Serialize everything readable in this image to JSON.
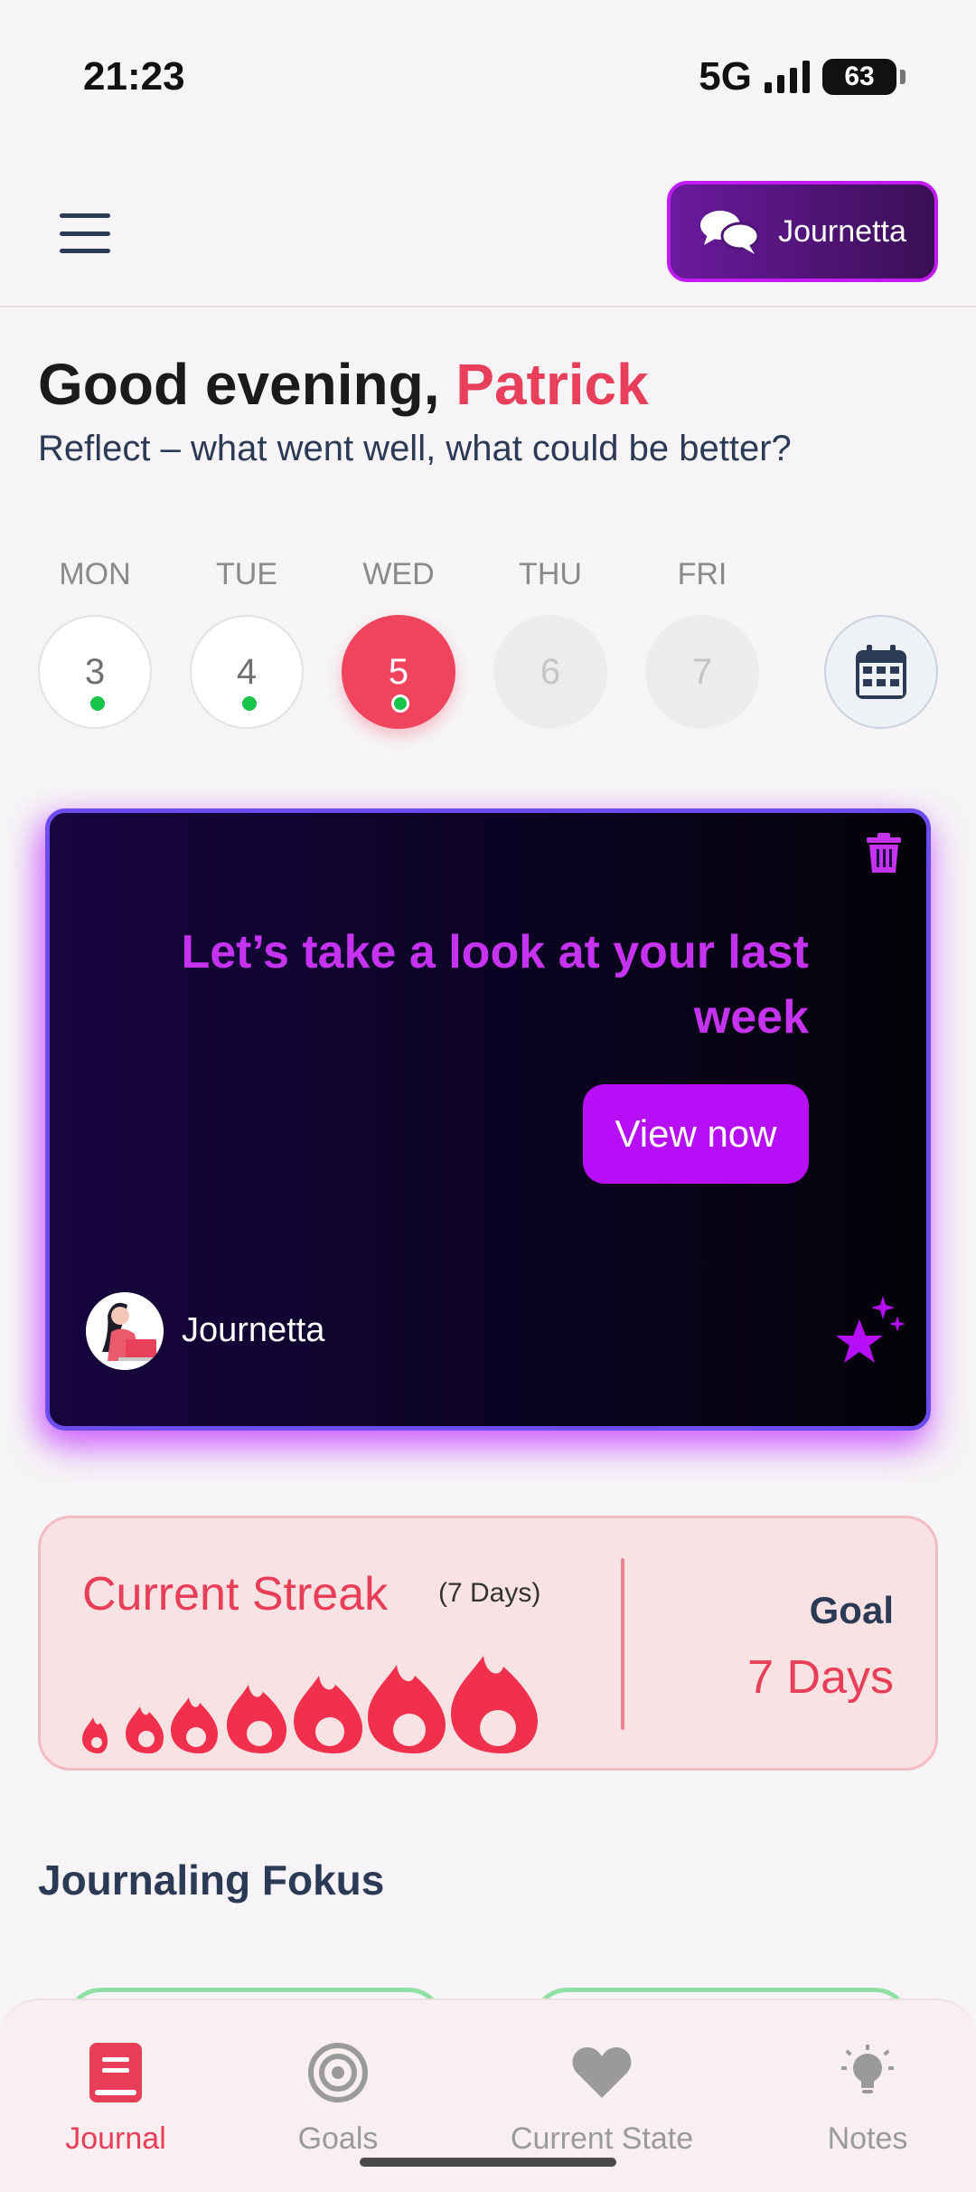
{
  "status_bar": {
    "time": "21:23",
    "network": "5G",
    "battery": "63"
  },
  "header": {
    "journetta_button_label": "Journetta"
  },
  "greeting": {
    "prefix": "Good evening, ",
    "name": "Patrick",
    "subtitle": "Reflect – what went well, what could be better?"
  },
  "week": {
    "days": [
      {
        "label": "MON",
        "number": "3"
      },
      {
        "label": "TUE",
        "number": "4"
      },
      {
        "label": "WED",
        "number": "5"
      },
      {
        "label": "THU",
        "number": "6"
      },
      {
        "label": "FRI",
        "number": "7"
      }
    ]
  },
  "promo": {
    "title": "Let’s take a look at your last week",
    "button_label": "View now",
    "author": "Journetta"
  },
  "streak": {
    "title": "Current Streak",
    "days": "(7 Days)",
    "goal_label": "Goal",
    "goal_value": "7 Days"
  },
  "section": {
    "title": "Journaling Fokus"
  },
  "bottom_nav": {
    "items": [
      {
        "label": "Journal",
        "icon": "journal-icon"
      },
      {
        "label": "Goals",
        "icon": "target-icon"
      },
      {
        "label": "Current State",
        "icon": "heart-icon"
      },
      {
        "label": "Notes",
        "icon": "lightbulb-icon"
      }
    ]
  },
  "colors": {
    "accent": "#e83e58",
    "purple": "#b70ef8",
    "green_dot": "#18c44a"
  }
}
